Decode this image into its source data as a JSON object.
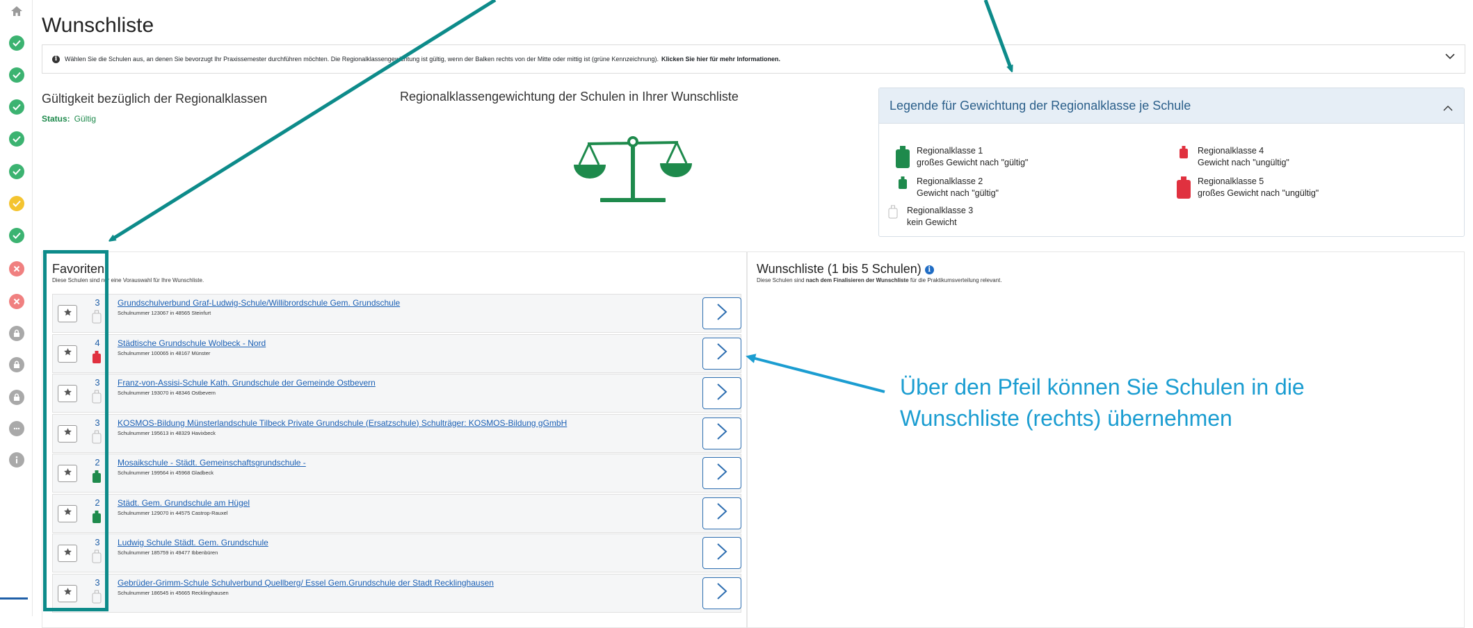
{
  "page_title": "Wunschliste",
  "sidebar": {
    "icons": [
      "home-icon",
      "check-icon",
      "check-icon",
      "check-icon",
      "check-icon",
      "check-icon",
      "check-icon",
      "warning-check-icon",
      "check-icon",
      "error-icon",
      "error-icon",
      "lock-icon",
      "lock-icon",
      "lock-icon",
      "chat-icon",
      "info-icon"
    ]
  },
  "info_bar": {
    "text": "Wählen Sie die Schulen aus, an denen Sie bevorzugt Ihr Praxissemester durchführen möchten. Die Regionalklassengewichtung ist gültig, wenn der Balken rechts von der Mitte oder mittig ist (grüne Kennzeichnung).",
    "link": "Klicken Sie hier für mehr Informationen."
  },
  "validity": {
    "heading": "Gültigkeit bezüglich der Regionalklassen",
    "status_label": "Status:",
    "status_value": "Gültig"
  },
  "weighting_heading": "Regionalklassengewichtung der Schulen in Ihrer Wunschliste",
  "legend": {
    "title": "Legende für Gewichtung der Regionalklasse je Schule",
    "items": [
      {
        "name": "Regionalklasse 1",
        "desc": "großes Gewicht nach \"gültig\""
      },
      {
        "name": "Regionalklasse 2",
        "desc": "Gewicht nach \"gültig\""
      },
      {
        "name": "Regionalklasse 3",
        "desc": "kein Gewicht"
      },
      {
        "name": "Regionalklasse 4",
        "desc": "Gewicht nach \"ungültig\""
      },
      {
        "name": "Regionalklasse 5",
        "desc": "großes Gewicht nach \"ungültig\""
      }
    ]
  },
  "favorites": {
    "title": "Favoriten",
    "subtitle": "Diese Schulen sind nur eine Vorauswahl für Ihre Wunschliste.",
    "rows": [
      {
        "rk": "3",
        "name": "Grundschulverbund Graf-Ludwig-Schule/Willibrordschule Gem. Grundschule",
        "nr": "Schulnummer 123067 in 48565 Steinfurt"
      },
      {
        "rk": "4",
        "name": "Städtische Grundschule Wolbeck - Nord",
        "nr": "Schulnummer 100065 in 48167 Münster"
      },
      {
        "rk": "3",
        "name": "Franz-von-Assisi-Schule Kath. Grundschule der Gemeinde Ostbevern",
        "nr": "Schulnummer 193070 in 48346 Ostbevern"
      },
      {
        "rk": "3",
        "name": "KOSMOS-Bildung Münsterlandschule Tilbeck Private Grundschule (Ersatzschule) Schulträger: KOSMOS-Bildung gGmbH",
        "nr": "Schulnummer 195613 in 48329 Havixbeck"
      },
      {
        "rk": "2",
        "name": "Mosaikschule - Städt. Gemeinschaftsgrundschule -",
        "nr": "Schulnummer 199564 in 45968 Gladbeck"
      },
      {
        "rk": "2",
        "name": "Städt. Gem. Grundschule am Hügel",
        "nr": "Schulnummer 129070 in 44575 Castrop-Rauxel"
      },
      {
        "rk": "3",
        "name": "Ludwig Schule Städt. Gem. Grundschule",
        "nr": "Schulnummer 185759 in 49477 Ibbenbüren"
      },
      {
        "rk": "3",
        "name": "Gebrüder-Grimm-Schule Schulverbund Quellberg/ Essel Gem.Grundschule der Stadt Recklinghausen",
        "nr": "Schulnummer 186545 in 45665 Recklinghausen"
      }
    ]
  },
  "wishlist": {
    "title": "Wunschliste (1 bis 5 Schulen)",
    "sub_pre": "Diese Schulen sind",
    "sub_bold": "nach dem Finalisieren der Wunschliste",
    "sub_post": "für die Praktikumsverteilung relevant."
  },
  "callout": "Über den Pfeil können Sie Schulen in die Wunschliste (rechts) übernehmen",
  "colors": {
    "teal": "#0d8b8a",
    "green": "#1e8a4c",
    "red": "#e0313f",
    "blue_link": "#1a5fb4",
    "callout": "#1b9dd1"
  }
}
